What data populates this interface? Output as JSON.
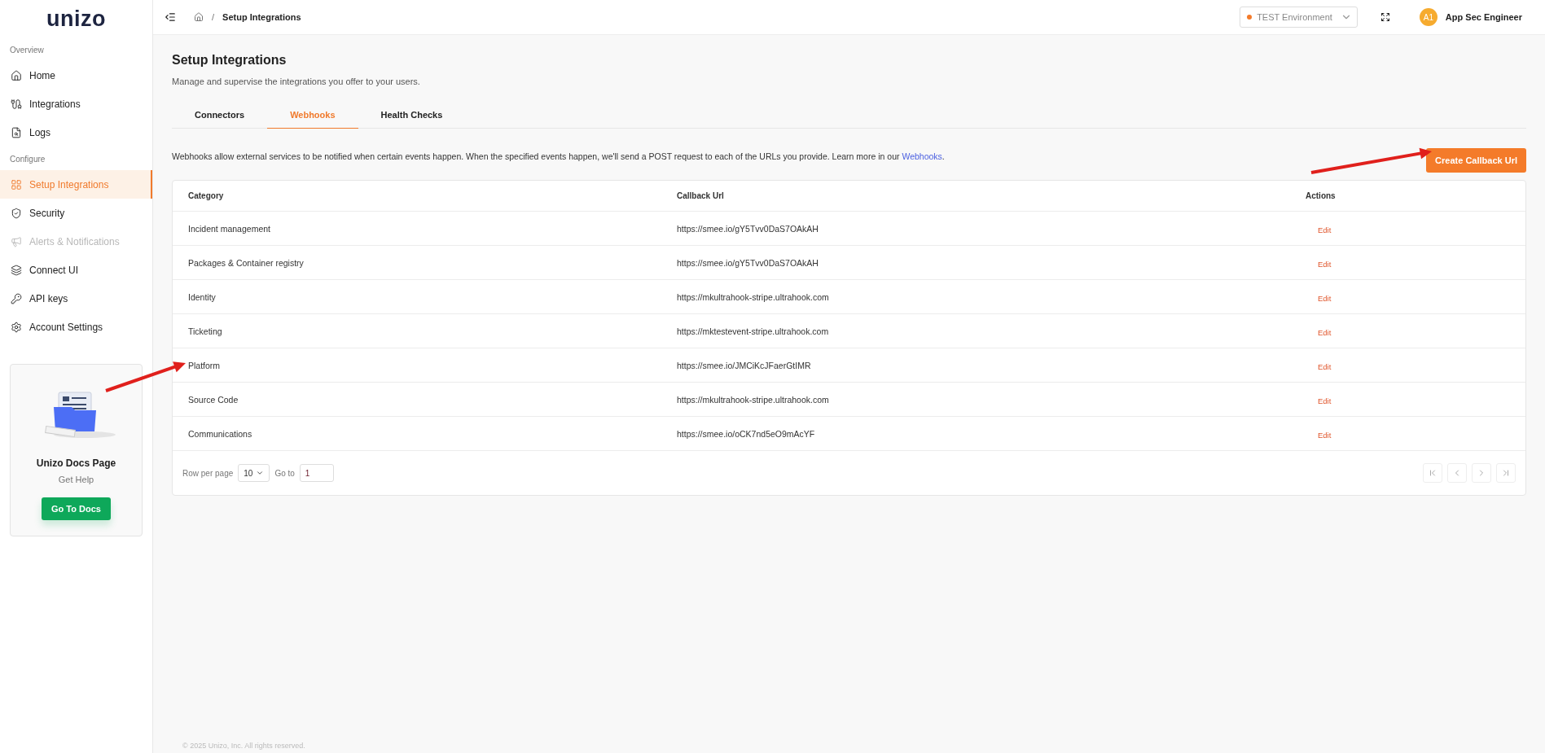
{
  "sidebar": {
    "logo": "unizo",
    "sections": [
      {
        "title": "Overview",
        "items": [
          {
            "label": "Home",
            "selected": false,
            "disabled": false
          },
          {
            "label": "Integrations",
            "selected": false,
            "disabled": false
          },
          {
            "label": "Logs",
            "selected": false,
            "disabled": false
          }
        ]
      },
      {
        "title": "Configure",
        "items": [
          {
            "label": "Setup Integrations",
            "selected": true,
            "disabled": false
          },
          {
            "label": "Security",
            "selected": false,
            "disabled": false
          },
          {
            "label": "Alerts & Notifications",
            "selected": false,
            "disabled": true
          },
          {
            "label": "Connect UI",
            "selected": false,
            "disabled": false
          },
          {
            "label": "API keys",
            "selected": false,
            "disabled": false
          },
          {
            "label": "Account Settings",
            "selected": false,
            "disabled": false
          }
        ]
      }
    ],
    "docs_card": {
      "title": "Unizo Docs Page",
      "subtitle": "Get Help",
      "button": "Go To Docs"
    }
  },
  "topbar": {
    "breadcrumb": [
      {
        "label": "/"
      },
      {
        "label": "Setup Integrations"
      }
    ],
    "environment": {
      "label": "TEST Environment",
      "color": "#f47b2a"
    },
    "user": {
      "initials": "A1",
      "name": "App Sec Engineer"
    }
  },
  "page": {
    "title": "Setup Integrations",
    "subtitle": "Manage and supervise the integrations you offer to your users.",
    "tabs": [
      {
        "label": "Connectors",
        "selected": false
      },
      {
        "label": "Webhooks",
        "selected": true
      },
      {
        "label": "Health Checks",
        "selected": false
      }
    ],
    "description": "Webhooks allow external services to be notified when certain events happen. When the specified events happen, we'll send a POST request to each of the URLs you provide. Learn more in our",
    "description_link": "Webhooks",
    "description_end": ".",
    "create_button": "Create Callback Url"
  },
  "table": {
    "columns": [
      "Category",
      "Callback Url",
      "Actions"
    ],
    "rows": [
      {
        "category": "Incident management",
        "url": "https://smee.io/gY5Tvv0DaS7OAkAH",
        "action": "Edit"
      },
      {
        "category": "Packages & Container registry",
        "url": "https://smee.io/gY5Tvv0DaS7OAkAH",
        "action": "Edit"
      },
      {
        "category": "Identity",
        "url": "https://mkultrahook-stripe.ultrahook.com",
        "action": "Edit"
      },
      {
        "category": "Ticketing",
        "url": "https://mktestevent-stripe.ultrahook.com",
        "action": "Edit"
      },
      {
        "category": "Platform",
        "url": "https://smee.io/JMCiKcJFaerGtIMR",
        "action": "Edit"
      },
      {
        "category": "Source Code",
        "url": "https://mkultrahook-stripe.ultrahook.com",
        "action": "Edit"
      },
      {
        "category": "Communications",
        "url": "https://smee.io/oCK7nd5eO9mAcYF",
        "action": "Edit"
      }
    ],
    "pagination": {
      "rows_label": "Row per page",
      "rows_value": "10",
      "goto_label": "Go to",
      "goto_value": "1"
    }
  },
  "footer": "© 2025 Unizo, Inc. All rights reserved."
}
